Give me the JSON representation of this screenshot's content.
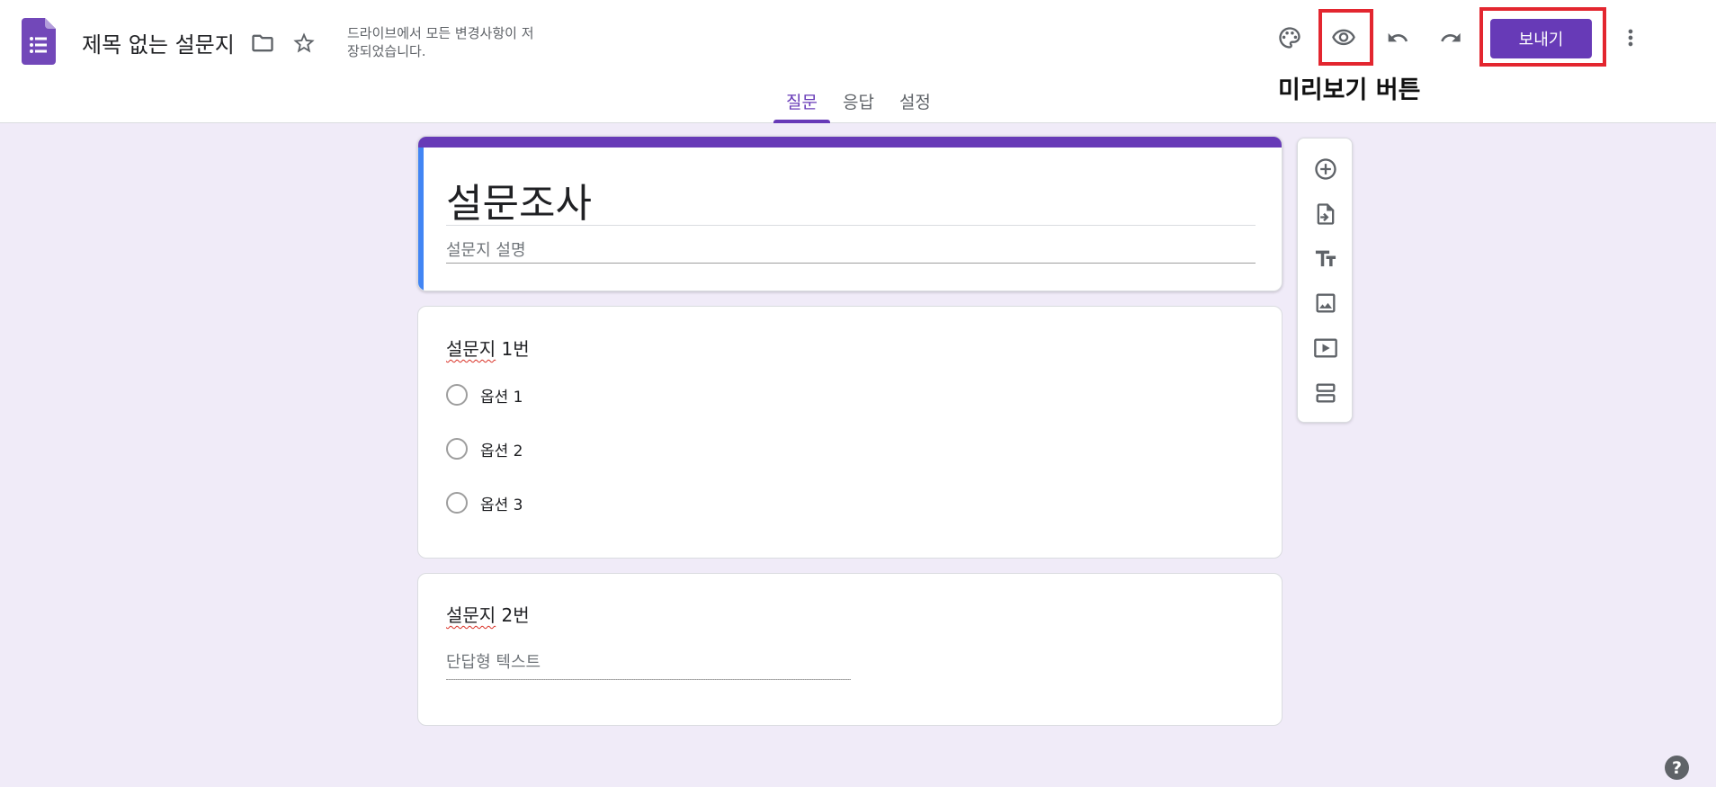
{
  "header": {
    "doc_title": "제목 없는 설문지",
    "save_status": "드라이브에서 모든 변경사항이 저장되었습니다.",
    "send_label": "보내기",
    "annotation": "미리보기 버튼",
    "icons": {
      "app": "forms-icon",
      "folder": "folder-icon",
      "star": "star-icon",
      "palette": "palette-icon",
      "preview": "eye-icon",
      "undo": "undo-icon",
      "redo": "redo-icon",
      "more": "more-vert-icon"
    }
  },
  "tabs": [
    {
      "label": "질문",
      "active": true
    },
    {
      "label": "응답",
      "active": false
    },
    {
      "label": "설정",
      "active": false
    }
  ],
  "form": {
    "title": "설문조사",
    "description": "설문지 설명"
  },
  "questions": [
    {
      "title_underlined": "설문지",
      "title_rest": " 1번",
      "type": "multiple-choice",
      "options": [
        "옵션 1",
        "옵션 2",
        "옵션 3"
      ]
    },
    {
      "title_underlined": "설문지",
      "title_rest": " 2번",
      "type": "short-answer",
      "placeholder": "단답형 텍스트"
    }
  ],
  "side_toolbar": [
    "add-question-icon",
    "import-questions-icon",
    "add-title-icon",
    "add-image-icon",
    "add-video-icon",
    "add-section-icon"
  ],
  "help": "?",
  "colors": {
    "accent": "#673ab7",
    "background": "#f0ebf8",
    "title_left_bar": "#4285f4",
    "annotation_box": "#e3262f"
  }
}
